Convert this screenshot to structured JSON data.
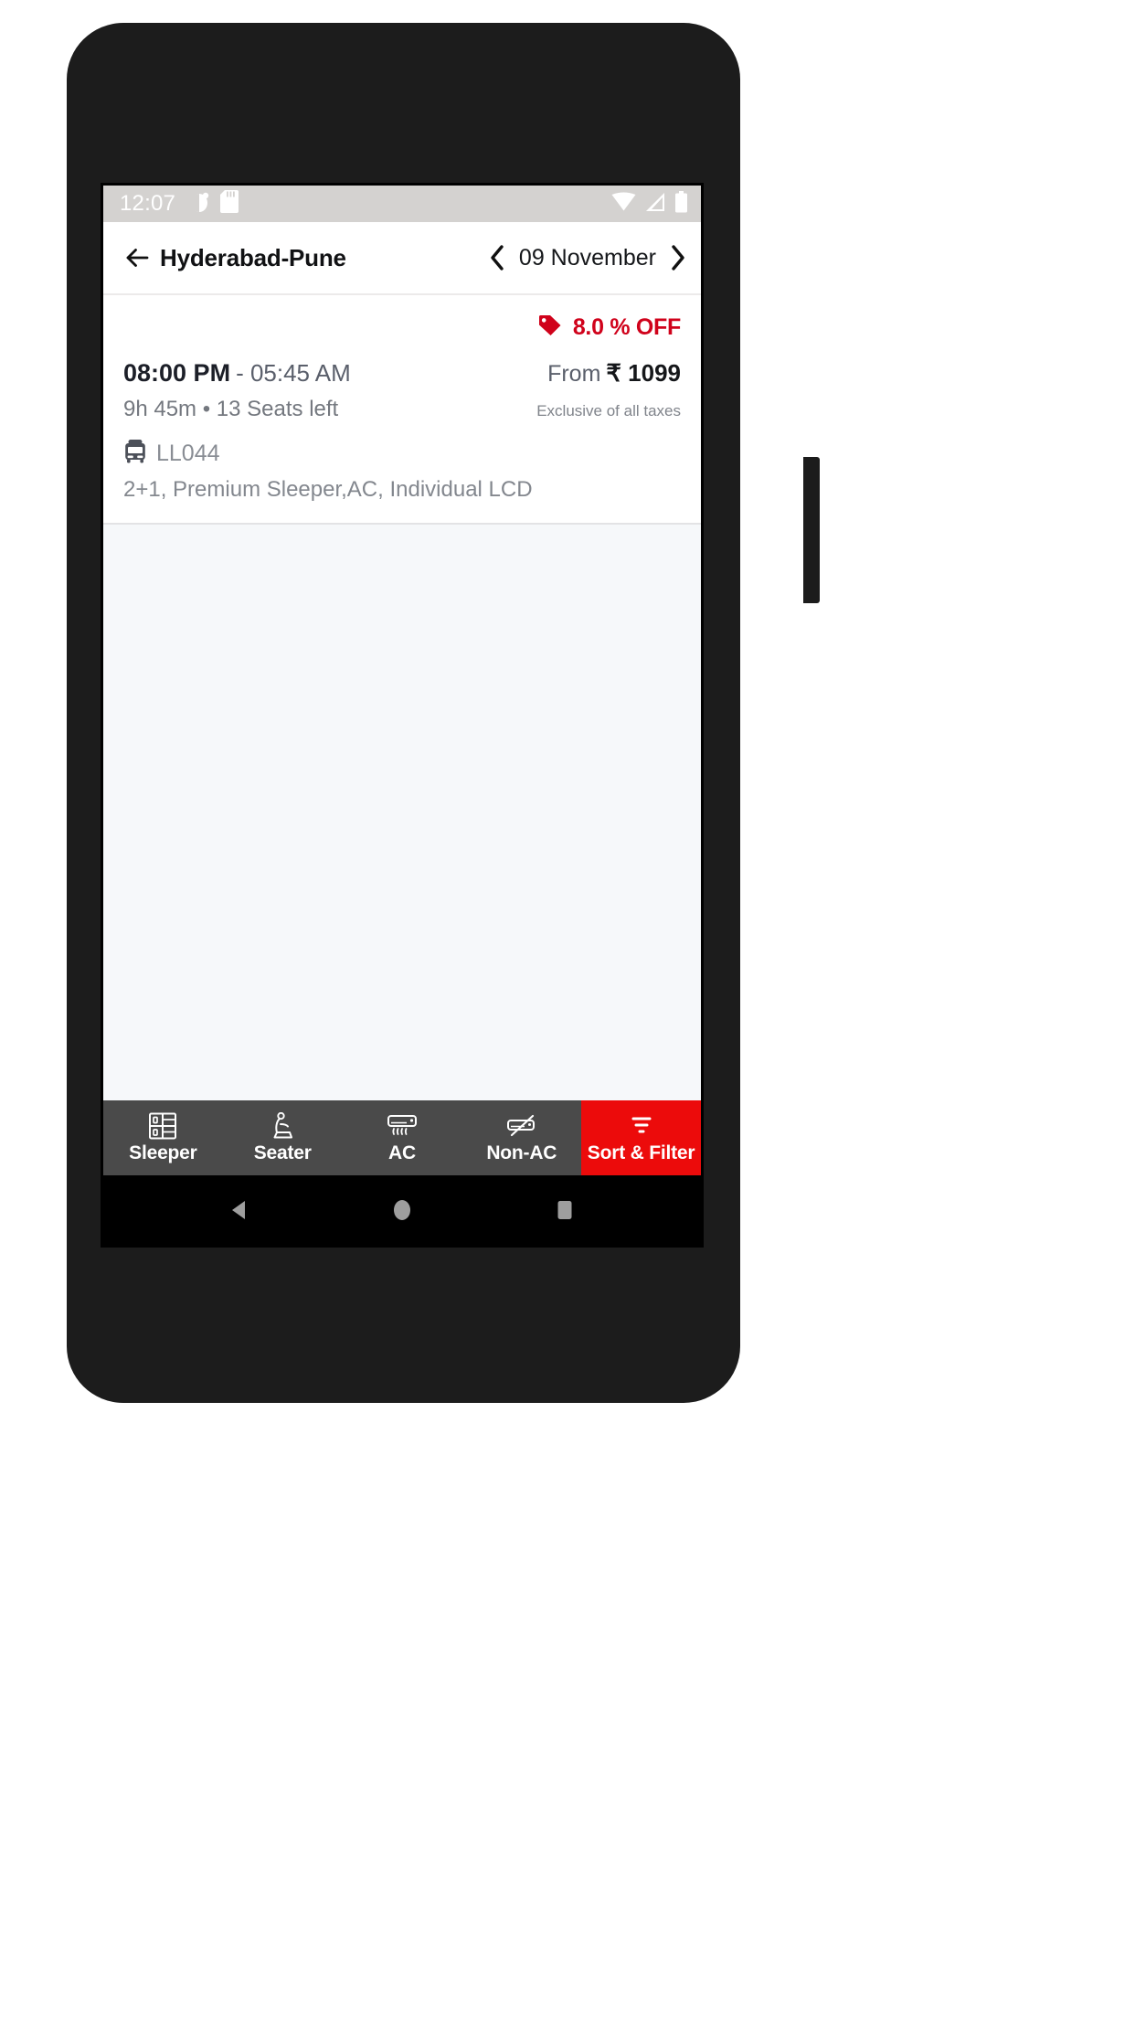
{
  "status_bar": {
    "time": "12:07",
    "left_icons": [
      "do-not-disturb-icon",
      "sd-card-icon"
    ],
    "right_icons": [
      "wifi-icon",
      "cell-signal-icon",
      "battery-icon"
    ]
  },
  "header": {
    "back_icon": "arrow-left-icon",
    "route_title": "Hyderabad-Pune",
    "prev_icon": "chevron-left-icon",
    "date": "09 November",
    "next_icon": "chevron-right-icon"
  },
  "result": {
    "discount_icon": "price-tag-icon",
    "discount": "8.0 % OFF",
    "discount_color": "#d0021b",
    "departure_time": "08:00 PM",
    "arrival_time": "- 05:45 AM",
    "price_from_label": "From",
    "price_amount": "₹ 1099",
    "duration_seats": "9h 45m  •  13 Seats left",
    "tax_note": "Exclusive of all taxes",
    "bus_icon": "bus-icon",
    "bus_number": "LL044",
    "amenities": "2+1, Premium Sleeper,AC, Individual LCD"
  },
  "filter_bar": {
    "accent_color": "#ec0b0b",
    "background_color": "#4a4a4a",
    "items": [
      {
        "label": "Sleeper",
        "icon": "sleeper-berth-icon",
        "active": false
      },
      {
        "label": "Seater",
        "icon": "seat-icon",
        "active": false
      },
      {
        "label": "AC",
        "icon": "air-conditioner-icon",
        "active": false
      },
      {
        "label": "Non-AC",
        "icon": "no-air-conditioner-icon",
        "active": false
      },
      {
        "label": "Sort & Filter",
        "icon": "filter-lines-icon",
        "active": true
      }
    ]
  },
  "android_nav": {
    "back": "nav-back-triangle-icon",
    "home": "nav-home-circle-icon",
    "recents": "nav-recents-square-icon"
  }
}
